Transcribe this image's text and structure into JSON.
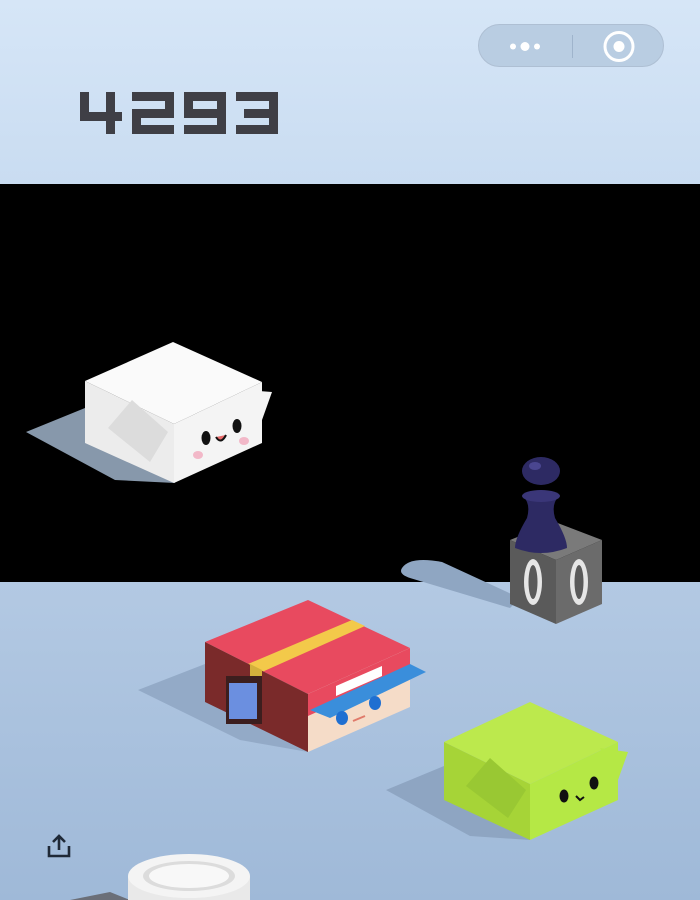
{
  "hud": {
    "score": "4293",
    "capsule": {
      "more_icon": "more-dots-icon",
      "close_icon": "target-close-icon"
    },
    "share_icon": "share-upload-icon"
  },
  "colors": {
    "sky": "#d6e6f7",
    "floor": "#a9c3e0",
    "score_text": "#3f3f46",
    "white_block": "#f4f4f4",
    "red_block": "#e84a5f",
    "green_block": "#b5e845",
    "player_piece": "#2d2a63",
    "dark_block": "#6b6b6b"
  },
  "scene": {
    "blocks": [
      "white-cat-block",
      "dark-speaker-block",
      "red-cap-block",
      "green-cat-block",
      "white-round-disc"
    ],
    "player": "player-chess-piece"
  }
}
